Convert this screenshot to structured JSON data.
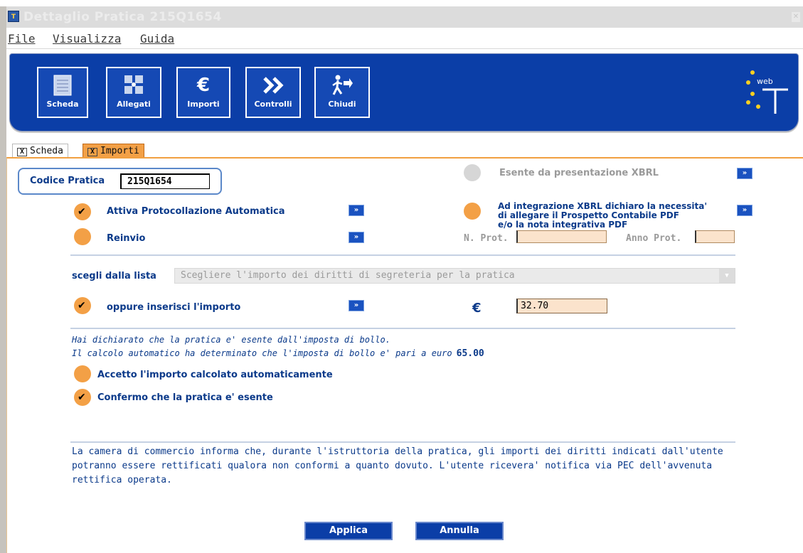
{
  "window": {
    "title": "Dettaglio Pratica 215Q1654",
    "icon_label": "T"
  },
  "menu": {
    "file": "File",
    "visualizza": "Visualizza",
    "guida": "Guida"
  },
  "toolbar": {
    "buttons": [
      {
        "label": "Scheda",
        "icon": "document-icon"
      },
      {
        "label": "Allegati",
        "icon": "attachments-icon"
      },
      {
        "label": "Importi",
        "icon": "euro-icon"
      },
      {
        "label": "Controlli",
        "icon": "double-chevron-icon"
      },
      {
        "label": "Chiudi",
        "icon": "exit-icon"
      }
    ],
    "brand_text": "web"
  },
  "tabs": {
    "scheda": "Scheda",
    "importi": "Importi",
    "close_mark": "X"
  },
  "form": {
    "codice_label": "Codice Pratica",
    "codice_value": "215Q1654",
    "esente_xbrl_label": "Esente da presentazione XBRL",
    "attiva_protocollazione_label": "Attiva Protocollazione Automatica",
    "integrazione_xbrl_label_line1": "Ad integrazione XBRL dichiaro la necessita'",
    "integrazione_xbrl_label_line2": "di allegare il Prospetto Contabile PDF",
    "integrazione_xbrl_label_line3": "e/o la nota integrativa PDF",
    "reinvio_label": "Reinvio",
    "n_prot_label": "N. Prot.",
    "anno_prot_label": "Anno Prot.",
    "scegli_label": "scegli dalla lista",
    "select_placeholder": "Scegliere l'importo dei diritti di segreteria per la pratica",
    "oppure_label": "oppure inserisci l'importo",
    "euro_symbol": "€",
    "amount_value": "32.70",
    "info_arrow": "»"
  },
  "bollo": {
    "note_line1": "Hai dichiarato che la pratica e' esente dall'imposta di bollo.",
    "note_line2": "Il calcolo automatico ha determinato che l'imposta di bollo e' pari a euro",
    "amount": "65.00",
    "accetto_label": "Accetto l'importo calcolato automaticamente",
    "confermo_label": "Confermo che la pratica e' esente"
  },
  "footer": {
    "note": "La camera di commercio informa che, durante l'istruttoria della pratica, gli importi dei diritti indicati dall'utente potranno essere rettificati qualora non conformi a quanto dovuto. L'utente ricevera' notifica via PEC dell'avvenuta rettifica operata."
  },
  "actions": {
    "applica": "Applica",
    "annulla": "Annulla"
  },
  "colors": {
    "toolbar_blue": "#0b3ea7",
    "accent_orange": "#f3a046",
    "label_blue": "#0b3a8a",
    "input_peach": "#fbe3cc"
  }
}
